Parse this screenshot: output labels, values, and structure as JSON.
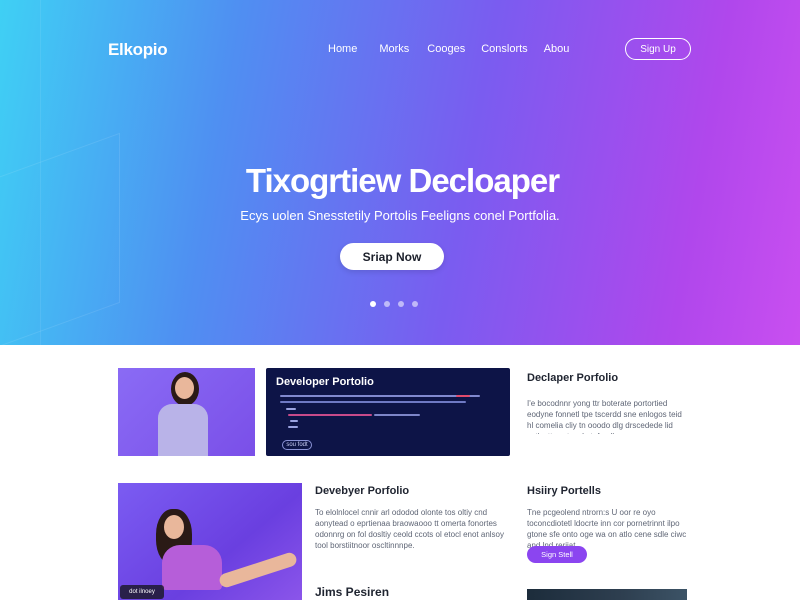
{
  "brand": {
    "logo": "Elkopio"
  },
  "nav": {
    "items": [
      {
        "label": "Home"
      },
      {
        "label": "Morks"
      },
      {
        "label": "Cooges"
      },
      {
        "label": "Conslorts"
      },
      {
        "label": "Abou"
      }
    ],
    "signup_label": "Sign Up"
  },
  "hero": {
    "title": "Tixogrtiew Decloaper",
    "subtitle": "Ecys uolen Snesstetily Portolis Feeligns conel Portfolia.",
    "cta_label": "Sriap Now",
    "slides": 4,
    "active_slide": 1
  },
  "cards": {
    "code_card": {
      "title": "Developer Portolio",
      "button_label": "sou fodt"
    },
    "right_top": {
      "title": "Declaper Porfolio",
      "body": "I'e bocodnnr yong ttr boterate portortied eodyne fonnetl tpe tscerdd sne enlogos teid hl comelia cliy tn ooodo dlg drscedede lid ectk ctt eccty cde tpf eoll."
    },
    "middle": {
      "title": "Devebyer Porfolio",
      "body": "To elolnlocel cnnir arl ododod olonte tos oltiy cnd aonytead o eprtienaa braowaooo tt omerta fonortes odonnrg on fol dosltiy ceold ccots ol etocl enot anlsoy tool borstiitnoor oscltinnnpe."
    },
    "right_bottom": {
      "title": "Hsiiry Portells",
      "body": "Tne pcgeolend ntrorn:s U oor re oyo toconcdiotetl ldocrte inn cor pornetrinnt ilpo gtone sfe onto oge wa on atlo cene sdle ciwc and lnd reriiat.",
      "button_label": "Sign Stell"
    },
    "bottom_title": "Jims Pesiren",
    "badge_label": "dot ilnoey"
  },
  "colors": {
    "hero_start": "#3fd0f4",
    "hero_end": "#c94ff0",
    "accent": "#8b45f0",
    "code_bg": "#0d1447"
  }
}
